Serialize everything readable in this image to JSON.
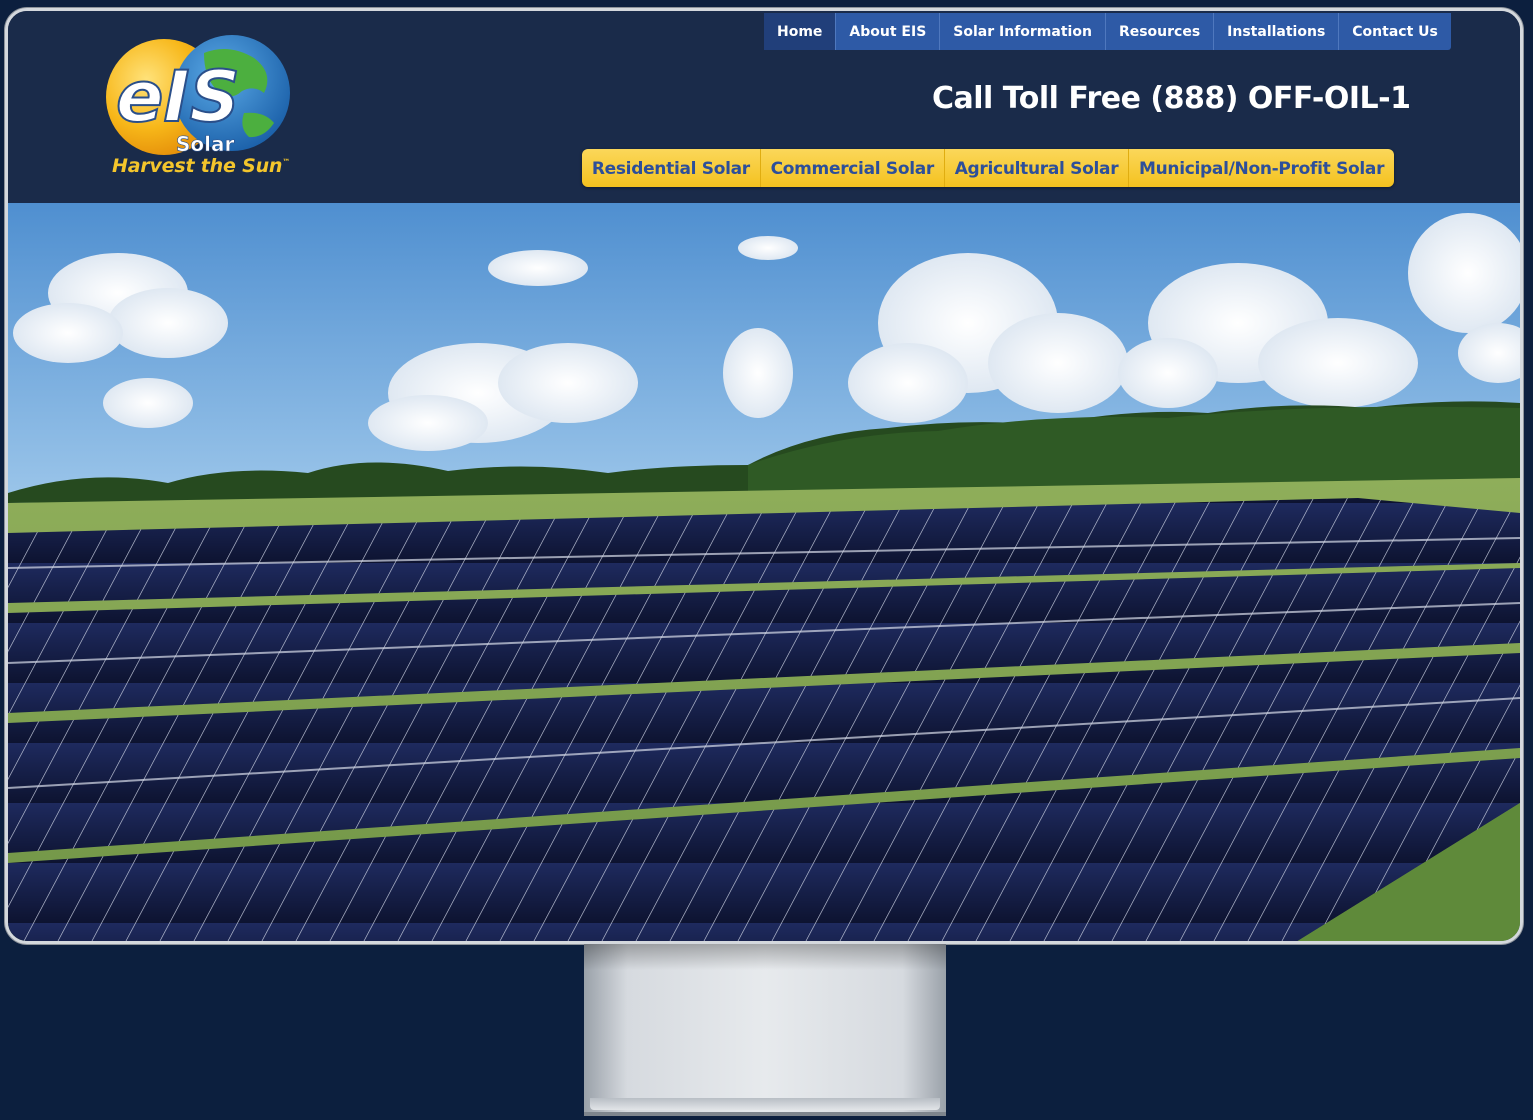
{
  "brand": {
    "logo_text": "eIS",
    "logo_sub": "Solar",
    "tagline": "Harvest the Sun",
    "trademark": "™"
  },
  "top_nav": {
    "items": [
      {
        "label": "Home",
        "active": true
      },
      {
        "label": "About EIS",
        "active": false
      },
      {
        "label": "Solar Information",
        "active": false
      },
      {
        "label": "Resources",
        "active": false
      },
      {
        "label": "Installations",
        "active": false
      },
      {
        "label": "Contact Us",
        "active": false
      }
    ]
  },
  "phone_text": "Call Toll Free (888) OFF-OIL-1",
  "sub_nav": {
    "items": [
      {
        "label": "Residential Solar"
      },
      {
        "label": "Commercial Solar"
      },
      {
        "label": "Agricultural Solar"
      },
      {
        "label": "Municipal/Non-Profit Solar"
      }
    ]
  },
  "colors": {
    "page_bg": "#0c1f3e",
    "header_bg": "#1a2b4a",
    "nav_blue": "#2e5aa6",
    "accent_yellow": "#f4c21f",
    "sub_nav_text": "#2d4f9a"
  },
  "hero": {
    "scene": "solar-farm-photo"
  }
}
